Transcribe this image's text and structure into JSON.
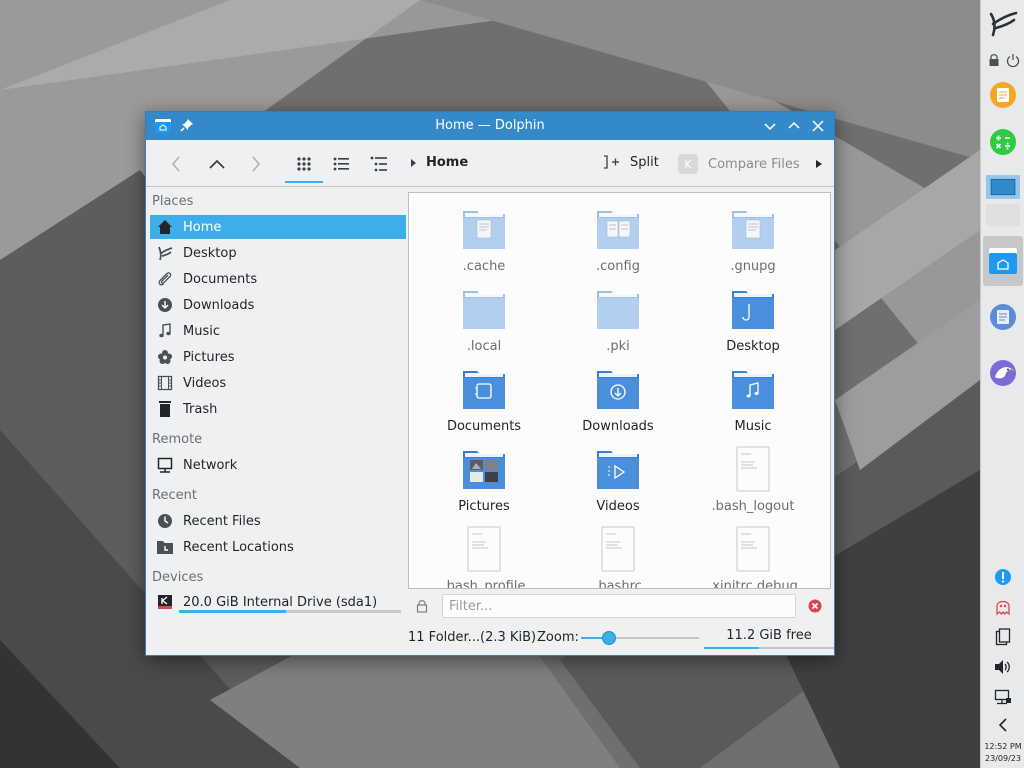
{
  "window": {
    "title": "Home — Dolphin"
  },
  "toolbar": {
    "breadcrumb": "Home",
    "split_label": "Split",
    "compare_label": "Compare Files"
  },
  "places": {
    "sections": {
      "places": "Places",
      "remote": "Remote",
      "recent": "Recent",
      "devices": "Devices"
    },
    "items": [
      {
        "label": "Home",
        "icon": "home-icon",
        "selected": true
      },
      {
        "label": "Desktop",
        "icon": "desktop-icon"
      },
      {
        "label": "Documents",
        "icon": "paperclip-icon"
      },
      {
        "label": "Downloads",
        "icon": "download-icon"
      },
      {
        "label": "Music",
        "icon": "music-note-icon"
      },
      {
        "label": "Pictures",
        "icon": "flower-icon"
      },
      {
        "label": "Videos",
        "icon": "film-icon"
      },
      {
        "label": "Trash",
        "icon": "trash-icon"
      },
      {
        "label": "Network",
        "icon": "network-icon"
      },
      {
        "label": "Recent Files",
        "icon": "clock-icon"
      },
      {
        "label": "Recent Locations",
        "icon": "folder-clock-icon"
      },
      {
        "label": "20.0 GiB Internal Drive (sda1)",
        "icon": "drive-icon",
        "usage": 0.48
      }
    ]
  },
  "files": [
    {
      "name": ".cache",
      "kind": "folder-light",
      "glyph": "doc"
    },
    {
      "name": ".config",
      "kind": "folder-light",
      "glyph": "docs"
    },
    {
      "name": ".gnupg",
      "kind": "folder-light",
      "glyph": "doc"
    },
    {
      "name": ".local",
      "kind": "folder-light",
      "glyph": ""
    },
    {
      "name": ".pki",
      "kind": "folder-light",
      "glyph": ""
    },
    {
      "name": "Desktop",
      "kind": "folder",
      "glyph": "desktop"
    },
    {
      "name": "Documents",
      "kind": "folder",
      "glyph": "documents"
    },
    {
      "name": "Downloads",
      "kind": "folder",
      "glyph": "downloads"
    },
    {
      "name": "Music",
      "kind": "folder",
      "glyph": "music"
    },
    {
      "name": "Pictures",
      "kind": "folder",
      "glyph": "pictures"
    },
    {
      "name": "Videos",
      "kind": "folder",
      "glyph": "videos"
    },
    {
      "name": ".bash_logout",
      "kind": "text-file",
      "glyph": ""
    },
    {
      "name": ".bash_profile",
      "kind": "text-file",
      "glyph": ""
    },
    {
      "name": ".bashrc",
      "kind": "text-file",
      "glyph": ""
    },
    {
      "name": ".xinitrc.debug",
      "kind": "text-file",
      "glyph": ""
    }
  ],
  "filter": {
    "placeholder": "Filter..."
  },
  "status": {
    "summary": "11 Folder...(2.3 KiB)",
    "zoom_label": "Zoom:",
    "zoom_level": 0.24,
    "free_space": "11.2 GiB free",
    "free_fraction": 0.42
  },
  "panel": {
    "time": "12:52 PM",
    "date": "23/09/23"
  },
  "colors": {
    "accent": "#3daee9",
    "titlebar": "#3489c8",
    "folder": "#4a8fdc",
    "folder_light": "#a9c8ee"
  }
}
